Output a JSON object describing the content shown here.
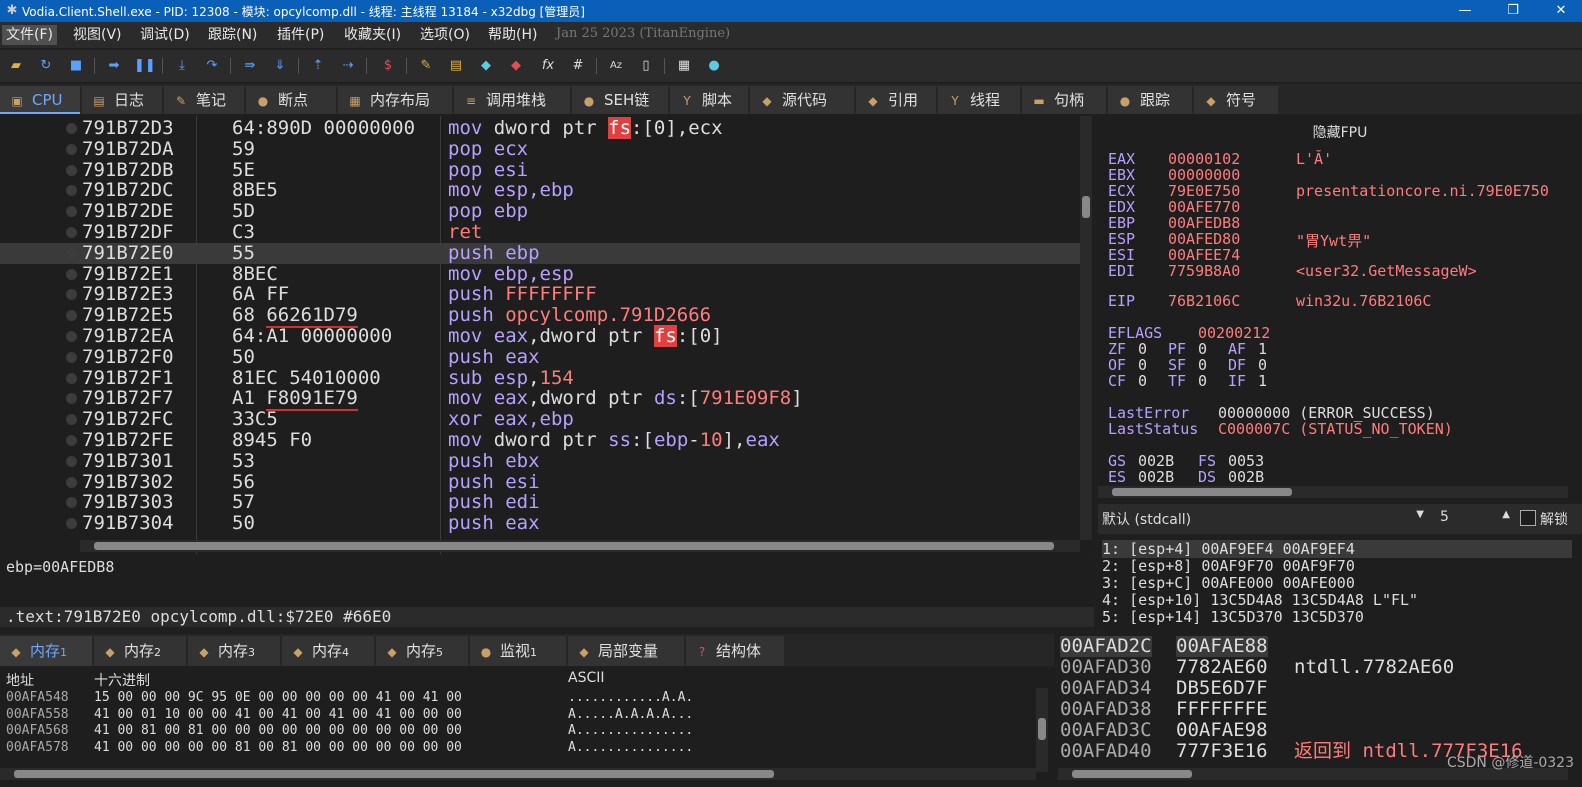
{
  "window": {
    "title": "Vodia.Client.Shell.exe - PID: 12308 - 模块: opcylcomp.dll - 线程: 主线程 13184 - x32dbg [管理员]",
    "minimize": "—",
    "restore": "❐"
  },
  "menu": {
    "items": [
      "文件(F)",
      "视图(V)",
      "调试(D)",
      "跟踪(N)",
      "插件(P)",
      "收藏夹(I)",
      "选项(O)",
      "帮助(H)"
    ],
    "build_date": "Jan 25 2023 (TitanEngine)"
  },
  "tabs": [
    "CPU",
    "日志",
    "笔记",
    "断点",
    "内存布局",
    "调用堆栈",
    "SEH链",
    "脚本",
    "源代码",
    "引用",
    "线程",
    "句柄",
    "跟踪",
    "符号"
  ],
  "disasm": {
    "rows": [
      {
        "addr": "791B72D3",
        "bytes": "64:890D 00000000",
        "asm": [
          [
            "kw",
            "mov "
          ],
          [
            "op",
            "dword ptr "
          ],
          [
            "seg",
            "fs"
          ],
          [
            "op",
            ":[0],ecx"
          ]
        ]
      },
      {
        "addr": "791B72DA",
        "bytes": "59",
        "asm": [
          [
            "kw",
            "pop "
          ],
          [
            "reg",
            "ecx"
          ]
        ]
      },
      {
        "addr": "791B72DB",
        "bytes": "5E",
        "asm": [
          [
            "kw",
            "pop "
          ],
          [
            "reg",
            "esi"
          ]
        ]
      },
      {
        "addr": "791B72DC",
        "bytes": "8BE5",
        "asm": [
          [
            "kw",
            "mov "
          ],
          [
            "reg",
            "esp,ebp"
          ]
        ]
      },
      {
        "addr": "791B72DE",
        "bytes": "5D",
        "asm": [
          [
            "kw",
            "pop "
          ],
          [
            "reg",
            "ebp"
          ]
        ]
      },
      {
        "addr": "791B72DF",
        "bytes": "C3",
        "asm": [
          [
            "num",
            "ret"
          ]
        ]
      },
      {
        "addr": "791B72E0",
        "bytes": "55",
        "asm": [
          [
            "kw",
            "push "
          ],
          [
            "reg",
            "ebp"
          ]
        ],
        "current": true
      },
      {
        "addr": "791B72E1",
        "bytes": "8BEC",
        "asm": [
          [
            "kw",
            "mov "
          ],
          [
            "reg",
            "ebp,esp"
          ]
        ]
      },
      {
        "addr": "791B72E3",
        "bytes": "6A FF",
        "asm": [
          [
            "kw",
            "push "
          ],
          [
            "num",
            "FFFFFFFF"
          ]
        ]
      },
      {
        "addr": "791B72E5",
        "bytes": "68 66261D79",
        "asm": [
          [
            "kw",
            "push "
          ],
          [
            "num",
            "opcylcomp.791D2666"
          ]
        ],
        "ul": true
      },
      {
        "addr": "791B72EA",
        "bytes": "64:A1 00000000",
        "asm": [
          [
            "kw",
            "mov "
          ],
          [
            "reg",
            "eax"
          ],
          [
            "op",
            ",dword ptr "
          ],
          [
            "seg",
            "fs"
          ],
          [
            "op",
            ":[0]"
          ]
        ]
      },
      {
        "addr": "791B72F0",
        "bytes": "50",
        "asm": [
          [
            "kw",
            "push "
          ],
          [
            "reg",
            "eax"
          ]
        ]
      },
      {
        "addr": "791B72F1",
        "bytes": "81EC 54010000",
        "asm": [
          [
            "kw",
            "sub "
          ],
          [
            "reg",
            "esp"
          ],
          [
            "op",
            ","
          ],
          [
            "num",
            "154"
          ]
        ]
      },
      {
        "addr": "791B72F7",
        "bytes": "A1 F8091E79",
        "asm": [
          [
            "kw",
            "mov "
          ],
          [
            "reg",
            "eax"
          ],
          [
            "op",
            ",dword ptr "
          ],
          [
            "reg",
            "ds"
          ],
          [
            "op",
            ":["
          ],
          [
            "num",
            "791E09F8"
          ],
          [
            "op",
            "]"
          ]
        ],
        "ul": true
      },
      {
        "addr": "791B72FC",
        "bytes": "33C5",
        "asm": [
          [
            "kw",
            "xor "
          ],
          [
            "reg",
            "eax,ebp"
          ]
        ]
      },
      {
        "addr": "791B72FE",
        "bytes": "8945 F0",
        "asm": [
          [
            "kw",
            "mov "
          ],
          [
            "op",
            "dword ptr "
          ],
          [
            "reg",
            "ss"
          ],
          [
            "op",
            ":["
          ],
          [
            "reg",
            "ebp"
          ],
          [
            "op",
            "-"
          ],
          [
            "num",
            "10"
          ],
          [
            "op",
            "],"
          ],
          [
            "reg",
            "eax"
          ]
        ]
      },
      {
        "addr": "791B7301",
        "bytes": "53",
        "asm": [
          [
            "kw",
            "push "
          ],
          [
            "reg",
            "ebx"
          ]
        ]
      },
      {
        "addr": "791B7302",
        "bytes": "56",
        "asm": [
          [
            "kw",
            "push "
          ],
          [
            "reg",
            "esi"
          ]
        ]
      },
      {
        "addr": "791B7303",
        "bytes": "57",
        "asm": [
          [
            "kw",
            "push "
          ],
          [
            "reg",
            "edi"
          ]
        ]
      },
      {
        "addr": "791B7304",
        "bytes": "50",
        "asm": [
          [
            "kw",
            "push "
          ],
          [
            "reg",
            "eax"
          ]
        ]
      }
    ]
  },
  "info": {
    "line1": "ebp=00AFEDB8",
    "line2": ".text:791B72E0 opcylcomp.dll:$72E0 #66E0"
  },
  "registers": {
    "header": "隐藏FPU",
    "gp": [
      {
        "name": "EAX",
        "value": "00000102",
        "comment": "L'Ă'"
      },
      {
        "name": "EBX",
        "value": "00000000",
        "comment": ""
      },
      {
        "name": "ECX",
        "value": "79E0E750",
        "comment": "presentationcore.ni.79E0E750"
      },
      {
        "name": "EDX",
        "value": "00AFE770",
        "comment": ""
      },
      {
        "name": "EBP",
        "value": "00AFEDB8",
        "comment": ""
      },
      {
        "name": "ESP",
        "value": "00AFED80",
        "comment": "\"胃Ywt畀\""
      },
      {
        "name": "ESI",
        "value": "00AFEE74",
        "comment": ""
      },
      {
        "name": "EDI",
        "value": "7759B8A0",
        "comment": "<user32.GetMessageW>"
      }
    ],
    "eip": {
      "name": "EIP",
      "value": "76B2106C",
      "comment": "win32u.76B2106C"
    },
    "eflags": {
      "name": "EFLAGS",
      "value": "00200212"
    },
    "flags": [
      [
        [
          "ZF",
          "0"
        ],
        [
          "PF",
          "0"
        ],
        [
          "AF",
          "1"
        ]
      ],
      [
        [
          "OF",
          "0"
        ],
        [
          "SF",
          "0"
        ],
        [
          "DF",
          "0"
        ]
      ],
      [
        [
          "CF",
          "0"
        ],
        [
          "TF",
          "0"
        ],
        [
          "IF",
          "1"
        ]
      ]
    ],
    "last_error": {
      "name": "LastError",
      "value": "00000000 (ERROR_SUCCESS)"
    },
    "last_status": {
      "name": "LastStatus",
      "value": "C000007C (STATUS_NO_TOKEN)"
    },
    "segs": [
      [
        [
          "GS",
          "002B"
        ],
        [
          "FS",
          "0053"
        ]
      ],
      [
        [
          "ES",
          "002B"
        ],
        [
          "DS",
          "002B"
        ]
      ]
    ]
  },
  "callconv": {
    "selected": "默认 (stdcall)",
    "count": "5",
    "unlock_label": "解锁"
  },
  "stack_args": [
    "1: [esp+4] 00AF9EF4 00AF9EF4",
    "2: [esp+8] 00AF9F70 00AF9F70",
    "3: [esp+C] 00AFE000 00AFE000",
    "4: [esp+10] 13C5D4A8 13C5D4A8 L\"FL\"",
    "5: [esp+14] 13C5D370 13C5D370"
  ],
  "mem_tabs": [
    {
      "label": "内存",
      "sub": "1"
    },
    {
      "label": "内存",
      "sub": "2"
    },
    {
      "label": "内存",
      "sub": "3"
    },
    {
      "label": "内存",
      "sub": "4"
    },
    {
      "label": "内存",
      "sub": "5"
    },
    {
      "label": "监视",
      "sub": "1"
    },
    {
      "label": "局部变量",
      "sub": ""
    },
    {
      "label": "结构体",
      "sub": ""
    }
  ],
  "dump": {
    "col_addr": "地址",
    "col_hex": "十六进制",
    "col_ascii": "ASCII",
    "rows": [
      {
        "addr": "00AFA548",
        "hex": "15 00 00 00 9C 95 0E 00 00 00 00 00 41 00 41 00",
        "ascii": "............A.A."
      },
      {
        "addr": "00AFA558",
        "hex": "41 00 01 10 00 00 41 00 41 00 41 00 41 00 00 00",
        "ascii": "A.....A.A.A.A..."
      },
      {
        "addr": "00AFA568",
        "hex": "41 00 81 00 81 00 00 00 00 00 00 00 00 00 00 00",
        "ascii": "A..............."
      },
      {
        "addr": "00AFA578",
        "hex": "41 00 00 00 00 00 81 00 81 00 00 00 00 00 00 00",
        "ascii": "A..............."
      }
    ]
  },
  "stack": [
    {
      "addr": "00AFAD2C",
      "value": "00AFAE88",
      "comment": "",
      "top": true
    },
    {
      "addr": "00AFAD30",
      "value": "7782AE60",
      "comment": "ntdll.7782AE60"
    },
    {
      "addr": "00AFAD34",
      "value": "DB5E6D7F",
      "comment": ""
    },
    {
      "addr": "00AFAD38",
      "value": "FFFFFFFE",
      "comment": ""
    },
    {
      "addr": "00AFAD3C",
      "value": "00AFAE98",
      "comment": ""
    },
    {
      "addr": "00AFAD40",
      "value": "777F3E16",
      "comment": "返回到 ntdll.777F3E16",
      "ret": true
    }
  ],
  "watermark": "CSDN @修道-0323",
  "colors": {
    "accent": "#6fa8ff",
    "highlight": "#ff7c7c",
    "keyword": "#b8a0ff",
    "title": "#0a60b8"
  }
}
